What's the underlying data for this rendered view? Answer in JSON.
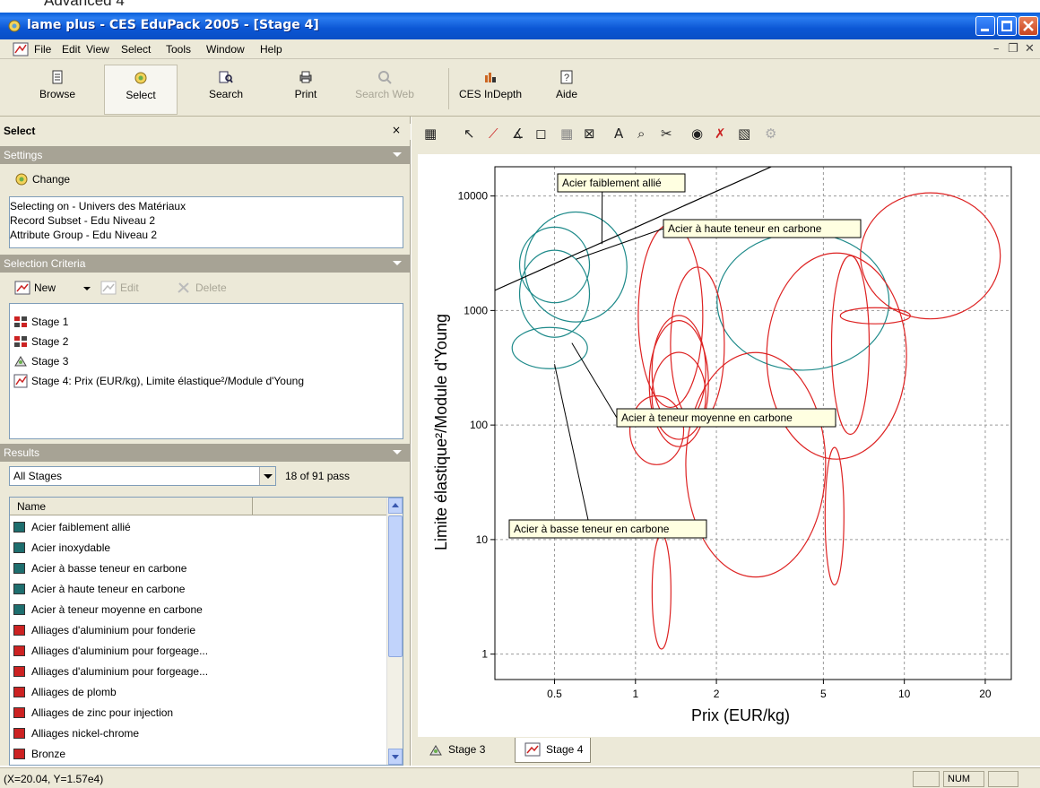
{
  "top_strip": {
    "text": "Advanced    4"
  },
  "window": {
    "title": "lame plus - CES EduPack 2005 - [Stage 4]"
  },
  "menu": {
    "items": [
      "File",
      "Edit",
      "View",
      "Select",
      "Tools",
      "Window",
      "Help"
    ]
  },
  "toolbar": {
    "browse": "Browse",
    "select": "Select",
    "search": "Search",
    "print": "Print",
    "search_web": "Search Web",
    "ces_indepth": "CES InDepth",
    "aide": "Aide"
  },
  "left": {
    "select_title": "Select",
    "settings": {
      "title": "Settings",
      "change_label": "Change",
      "lines": [
        "Selecting on - Univers des Matériaux",
        "Record Subset - Edu Niveau 2",
        "Attribute Group - Edu Niveau 2"
      ]
    },
    "criteria": {
      "title": "Selection Criteria",
      "new_label": "New",
      "edit_label": "Edit",
      "delete_label": "Delete",
      "stages": [
        "Stage 1",
        "Stage 2",
        "Stage 3",
        "Stage 4: Prix (EUR/kg), Limite élastique²/Module d'Young"
      ]
    },
    "results": {
      "title": "Results",
      "filter_value": "All Stages",
      "pass_count": "18 of 91 pass",
      "column_name": "Name",
      "items": [
        "Acier faiblement allié",
        "Acier inoxydable",
        "Acier à basse teneur en carbone",
        "Acier à haute teneur en carbone",
        "Acier à teneur moyenne en carbone",
        "Alliages d'aluminium pour fonderie",
        "Alliages d'aluminium pour forgeage...",
        "Alliages d'aluminium pour forgeage...",
        "Alliages de plomb",
        "Alliages de zinc pour injection",
        "Alliages nickel-chrome",
        "Bronze"
      ]
    }
  },
  "chart_data": {
    "type": "scatter",
    "xlabel": "Prix (EUR/kg)",
    "ylabel": "Limite élastique²/Module d'Young",
    "xscale": "log",
    "yscale": "log",
    "xlim": [
      0.3,
      25
    ],
    "ylim": [
      0.6,
      18000
    ],
    "xticks": [
      0.5,
      1,
      2,
      5,
      10,
      20
    ],
    "xtick_labels": [
      "0.5",
      "1",
      "2",
      "5",
      "10",
      "20"
    ],
    "yticks": [
      1,
      10,
      100,
      1000,
      10000
    ],
    "ytick_labels": [
      "1",
      "10",
      "100",
      "1000",
      "10000"
    ],
    "grid": true,
    "selection_line": {
      "from": [
        0.3,
        1500
      ],
      "to": [
        3.2,
        18000
      ]
    },
    "colors": {
      "selected": "#1e8a8a",
      "failed": "#dd2222",
      "line": "#000000"
    },
    "materials": [
      {
        "name": "Acier faiblement allié",
        "group": "selected",
        "cx": 0.6,
        "cy": 2400,
        "rx_decades": 0.19,
        "ry_decades": 0.48
      },
      {
        "name": "Acier à haute teneur en carbone",
        "group": "selected",
        "cx": 0.5,
        "cy": 2500,
        "rx_decades": 0.13,
        "ry_decades": 0.33
      },
      {
        "name": "Acier à teneur moyenne en carbone",
        "group": "selected",
        "cx": 0.5,
        "cy": 1400,
        "rx_decades": 0.13,
        "ry_decades": 0.38
      },
      {
        "name": "Acier à basse teneur en carbone",
        "group": "selected",
        "cx": 0.48,
        "cy": 470,
        "rx_decades": 0.14,
        "ry_decades": 0.18
      },
      {
        "name": "Acier inoxydable",
        "group": "selected",
        "cx": 4.2,
        "cy": 1200,
        "rx_decades": 0.32,
        "ry_decades": 0.6
      },
      {
        "name": "",
        "group": "failed",
        "cx": 1.35,
        "cy": 900,
        "rx_decades": 0.12,
        "ry_decades": 0.8
      },
      {
        "name": "",
        "group": "failed",
        "cx": 1.7,
        "cy": 500,
        "rx_decades": 0.1,
        "ry_decades": 0.68
      },
      {
        "name": "",
        "group": "failed",
        "cx": 1.45,
        "cy": 230,
        "rx_decades": 0.11,
        "ry_decades": 0.55
      },
      {
        "name": "",
        "group": "failed",
        "cx": 1.45,
        "cy": 300,
        "rx_decades": 0.1,
        "ry_decades": 0.48
      },
      {
        "name": "",
        "group": "failed",
        "cx": 1.45,
        "cy": 180,
        "rx_decades": 0.1,
        "ry_decades": 0.38
      },
      {
        "name": "",
        "group": "failed",
        "cx": 1.2,
        "cy": 90,
        "rx_decades": 0.1,
        "ry_decades": 0.3
      },
      {
        "name": "",
        "group": "failed",
        "cx": 2.8,
        "cy": 45,
        "rx_decades": 0.26,
        "ry_decades": 0.98
      },
      {
        "name": "",
        "group": "failed",
        "cx": 5.6,
        "cy": 400,
        "rx_decades": 0.26,
        "ry_decades": 0.9
      },
      {
        "name": "",
        "group": "failed",
        "cx": 6.3,
        "cy": 500,
        "rx_decades": 0.07,
        "ry_decades": 0.78
      },
      {
        "name": "",
        "group": "failed",
        "cx": 12.5,
        "cy": 3000,
        "rx_decades": 0.26,
        "ry_decades": 0.55
      },
      {
        "name": "",
        "group": "failed",
        "cx": 7.8,
        "cy": 900,
        "rx_decades": 0.13,
        "ry_decades": 0.07
      },
      {
        "name": "",
        "group": "failed",
        "cx": 5.5,
        "cy": 16,
        "rx_decades": 0.035,
        "ry_decades": 0.6
      },
      {
        "name": "",
        "group": "failed",
        "cx": 1.25,
        "cy": 3.5,
        "rx_decades": 0.035,
        "ry_decades": 0.5
      }
    ],
    "annotations": [
      {
        "text": "Acier faiblement allié",
        "target": [
          0.75,
          3800
        ]
      },
      {
        "text": "Acier à haute teneur en carbone",
        "target": [
          0.6,
          2800
        ]
      },
      {
        "text": "Acier à teneur moyenne en carbone",
        "target": [
          0.58,
          520
        ]
      },
      {
        "text": "Acier à basse teneur en carbone",
        "target": [
          0.5,
          340
        ]
      }
    ]
  },
  "tabs": {
    "stage3": "Stage 3",
    "stage4": "Stage 4"
  },
  "status": {
    "coords": "(X=20.04, Y=1.57e4)",
    "num": "NUM"
  }
}
